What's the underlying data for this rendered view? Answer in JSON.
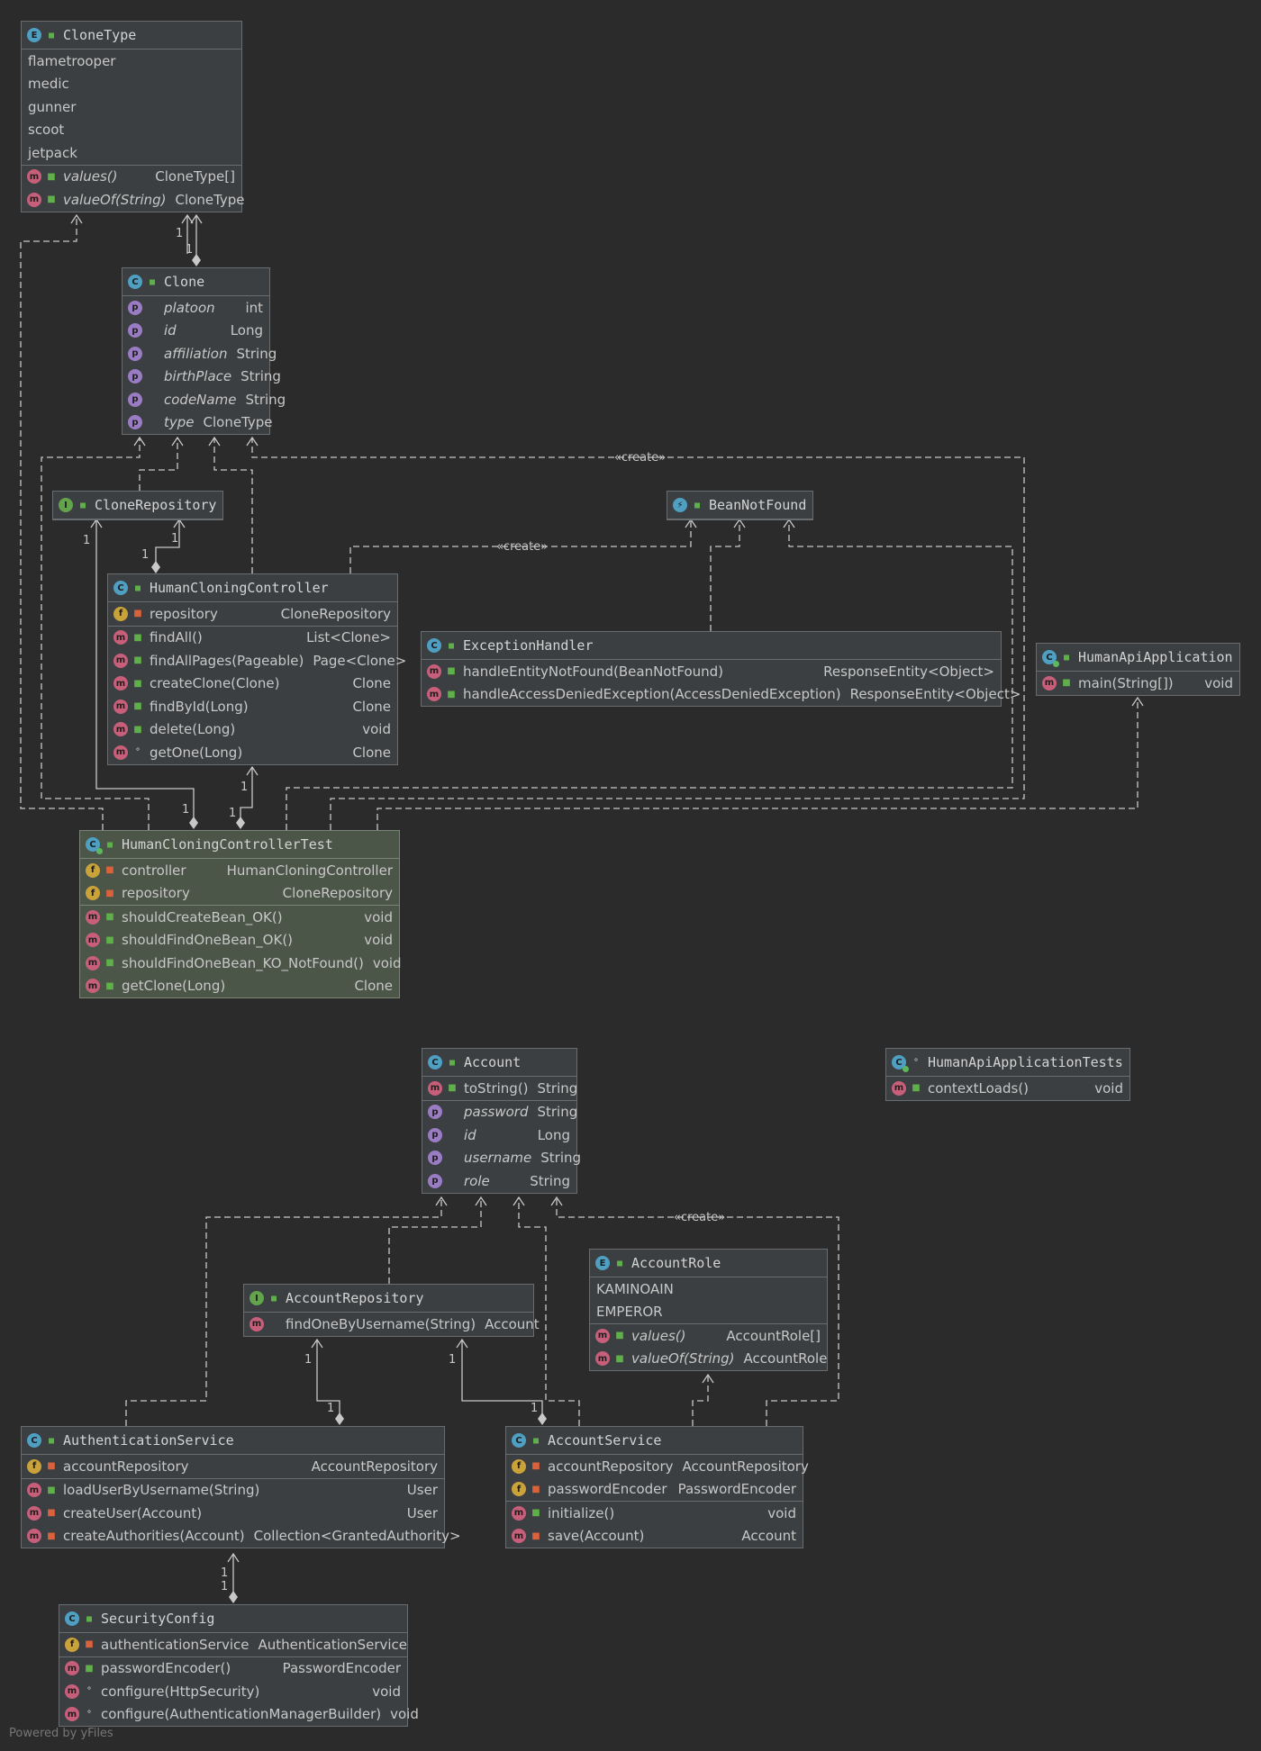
{
  "nodes": [
    {
      "id": "CloneType",
      "kind": "E",
      "name": "CloneType",
      "constants": [
        "flametrooper",
        "medic",
        "gunner",
        "scoot",
        "jetpack"
      ],
      "members": [
        {
          "k": "m",
          "vis": "pub",
          "name": "values()",
          "type": "CloneType[]",
          "italic": true
        },
        {
          "k": "m",
          "vis": "pub",
          "name": "valueOf(String)",
          "type": "CloneType",
          "italic": true
        }
      ]
    },
    {
      "id": "Clone",
      "kind": "C",
      "name": "Clone",
      "members": [
        {
          "k": "p",
          "vis": "",
          "name": "platoon",
          "type": "int",
          "italic": true
        },
        {
          "k": "p",
          "vis": "",
          "name": "id",
          "type": "Long",
          "italic": true
        },
        {
          "k": "p",
          "vis": "",
          "name": "affiliation",
          "type": "String",
          "italic": true
        },
        {
          "k": "p",
          "vis": "",
          "name": "birthPlace",
          "type": "String",
          "italic": true
        },
        {
          "k": "p",
          "vis": "",
          "name": "codeName",
          "type": "String",
          "italic": true
        },
        {
          "k": "p",
          "vis": "",
          "name": "type",
          "type": "CloneType",
          "italic": true
        }
      ]
    },
    {
      "id": "CloneRepository",
      "kind": "I",
      "name": "CloneRepository",
      "members": []
    },
    {
      "id": "BeanNotFound",
      "kind": "A",
      "name": "BeanNotFound",
      "members": []
    },
    {
      "id": "HumanCloningController",
      "kind": "C",
      "name": "HumanCloningController",
      "fields": [
        {
          "k": "f",
          "vis": "pri",
          "name": "repository",
          "type": "CloneRepository"
        }
      ],
      "members": [
        {
          "k": "m",
          "vis": "pub",
          "name": "findAll()",
          "type": "List<Clone>"
        },
        {
          "k": "m",
          "vis": "pub",
          "name": "findAllPages(Pageable)",
          "type": "Page<Clone>"
        },
        {
          "k": "m",
          "vis": "pub",
          "name": "createClone(Clone)",
          "type": "Clone"
        },
        {
          "k": "m",
          "vis": "pub",
          "name": "findById(Long)",
          "type": "Clone"
        },
        {
          "k": "m",
          "vis": "pub",
          "name": "delete(Long)",
          "type": "void"
        },
        {
          "k": "m",
          "vis": "pkg",
          "name": "getOne(Long)",
          "type": "Clone"
        }
      ]
    },
    {
      "id": "ExceptionHandler",
      "kind": "C",
      "name": "ExceptionHandler",
      "members": [
        {
          "k": "m",
          "vis": "pub",
          "name": "handleEntityNotFound(BeanNotFound)",
          "type": "ResponseEntity<Object>"
        },
        {
          "k": "m",
          "vis": "pub",
          "name": "handleAccessDeniedException(AccessDeniedException)",
          "type": "ResponseEntity<Object>"
        }
      ]
    },
    {
      "id": "HumanApiApplication",
      "kind": "C",
      "run": true,
      "name": "HumanApiApplication",
      "members": [
        {
          "k": "m",
          "vis": "pub",
          "name": "main(String[])",
          "type": "void"
        }
      ]
    },
    {
      "id": "HumanCloningControllerTest",
      "kind": "C",
      "run": true,
      "test": true,
      "name": "HumanCloningControllerTest",
      "fields": [
        {
          "k": "f",
          "vis": "pri",
          "name": "controller",
          "type": "HumanCloningController"
        },
        {
          "k": "f",
          "vis": "pri",
          "name": "repository",
          "type": "CloneRepository"
        }
      ],
      "members": [
        {
          "k": "m",
          "vis": "pub",
          "name": "shouldCreateBean_OK()",
          "type": "void"
        },
        {
          "k": "m",
          "vis": "pub",
          "name": "shouldFindOneBean_OK()",
          "type": "void"
        },
        {
          "k": "m",
          "vis": "pub",
          "name": "shouldFindOneBean_KO_NotFound()",
          "type": "void"
        },
        {
          "k": "m",
          "vis": "pub",
          "name": "getClone(Long)",
          "type": "Clone"
        }
      ]
    },
    {
      "id": "Account",
      "kind": "C",
      "name": "Account",
      "fields": [
        {
          "k": "m",
          "vis": "pub",
          "name": "toString()",
          "type": "String"
        }
      ],
      "members": [
        {
          "k": "p",
          "vis": "",
          "name": "password",
          "type": "String",
          "italic": true
        },
        {
          "k": "p",
          "vis": "",
          "name": "id",
          "type": "Long",
          "italic": true
        },
        {
          "k": "p",
          "vis": "",
          "name": "username",
          "type": "String",
          "italic": true
        },
        {
          "k": "p",
          "vis": "",
          "name": "role",
          "type": "String",
          "italic": true
        }
      ]
    },
    {
      "id": "HumanApiApplicationTests",
      "kind": "C",
      "run": true,
      "name": "HumanApiApplicationTests",
      "hvis": "pkg",
      "members": [
        {
          "k": "m",
          "vis": "pub",
          "name": "contextLoads()",
          "type": "void"
        }
      ]
    },
    {
      "id": "AccountRole",
      "kind": "E",
      "name": "AccountRole",
      "constants": [
        "KAMINOAIN",
        "EMPEROR"
      ],
      "members": [
        {
          "k": "m",
          "vis": "pub",
          "name": "values()",
          "type": "AccountRole[]",
          "italic": true
        },
        {
          "k": "m",
          "vis": "pub",
          "name": "valueOf(String)",
          "type": "AccountRole",
          "italic": true
        }
      ]
    },
    {
      "id": "AccountRepository",
      "kind": "I",
      "name": "AccountRepository",
      "members": [
        {
          "k": "m",
          "vis": "",
          "name": "findOneByUsername(String)",
          "type": "Account"
        }
      ]
    },
    {
      "id": "AuthenticationService",
      "kind": "C",
      "name": "AuthenticationService",
      "fields": [
        {
          "k": "f",
          "vis": "pri",
          "name": "accountRepository",
          "type": "AccountRepository"
        }
      ],
      "members": [
        {
          "k": "m",
          "vis": "pub",
          "name": "loadUserByUsername(String)",
          "type": "User"
        },
        {
          "k": "m",
          "vis": "pri",
          "name": "createUser(Account)",
          "type": "User"
        },
        {
          "k": "m",
          "vis": "pri",
          "name": "createAuthorities(Account)",
          "type": "Collection<GrantedAuthority>"
        }
      ]
    },
    {
      "id": "AccountService",
      "kind": "C",
      "name": "AccountService",
      "fields": [
        {
          "k": "f",
          "vis": "pri",
          "name": "accountRepository",
          "type": "AccountRepository"
        },
        {
          "k": "f",
          "vis": "pri",
          "name": "passwordEncoder",
          "type": "PasswordEncoder"
        }
      ],
      "members": [
        {
          "k": "m",
          "vis": "pub",
          "name": "initialize()",
          "type": "void"
        },
        {
          "k": "m",
          "vis": "pri",
          "name": "save(Account)",
          "type": "Account"
        }
      ]
    },
    {
      "id": "SecurityConfig",
      "kind": "C",
      "name": "SecurityConfig",
      "fields": [
        {
          "k": "f",
          "vis": "pri",
          "name": "authenticationService",
          "type": "AuthenticationService"
        }
      ],
      "members": [
        {
          "k": "m",
          "vis": "pub",
          "name": "passwordEncoder()",
          "type": "PasswordEncoder"
        },
        {
          "k": "m",
          "vis": "pkg",
          "name": "configure(HttpSecurity)",
          "type": "void"
        },
        {
          "k": "m",
          "vis": "pkg",
          "name": "configure(AuthenticationManagerBuilder)",
          "type": "void"
        }
      ]
    }
  ],
  "labels": {
    "create": "«create»",
    "one": "1"
  },
  "footer": "Powered by yFiles",
  "colors": {
    "background": "#2b2b2b",
    "box": "#3c3f41",
    "testBox": "#4b5548",
    "edge": "#c8c8c8"
  }
}
